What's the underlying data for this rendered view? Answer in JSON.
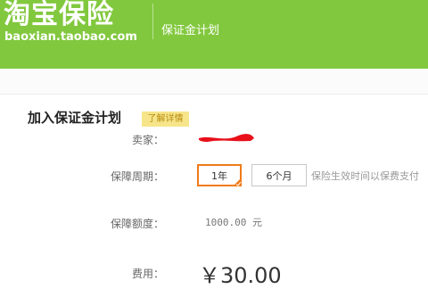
{
  "header": {
    "logo_text": "淘宝保险",
    "logo_url": "baoxian.taobao.com",
    "title": "保证金计划"
  },
  "form": {
    "title": "加入保证金计划",
    "details_link": "了解详情",
    "seller_label": "卖家：",
    "period_label": "保障周期：",
    "period_options": [
      {
        "label": "1年",
        "selected": true
      },
      {
        "label": "6个月",
        "selected": false
      }
    ],
    "period_hint": "保险生效时间以保费支付",
    "amount_label": "保障额度：",
    "amount_value": "1000.00 元",
    "fee_label": "费用：",
    "fee_value": "￥30.00"
  },
  "colors": {
    "header_bg": "#82c83e",
    "selected_border": "#f07a18",
    "redaction": "#e8101a",
    "details_bg": "#f6e58a"
  }
}
